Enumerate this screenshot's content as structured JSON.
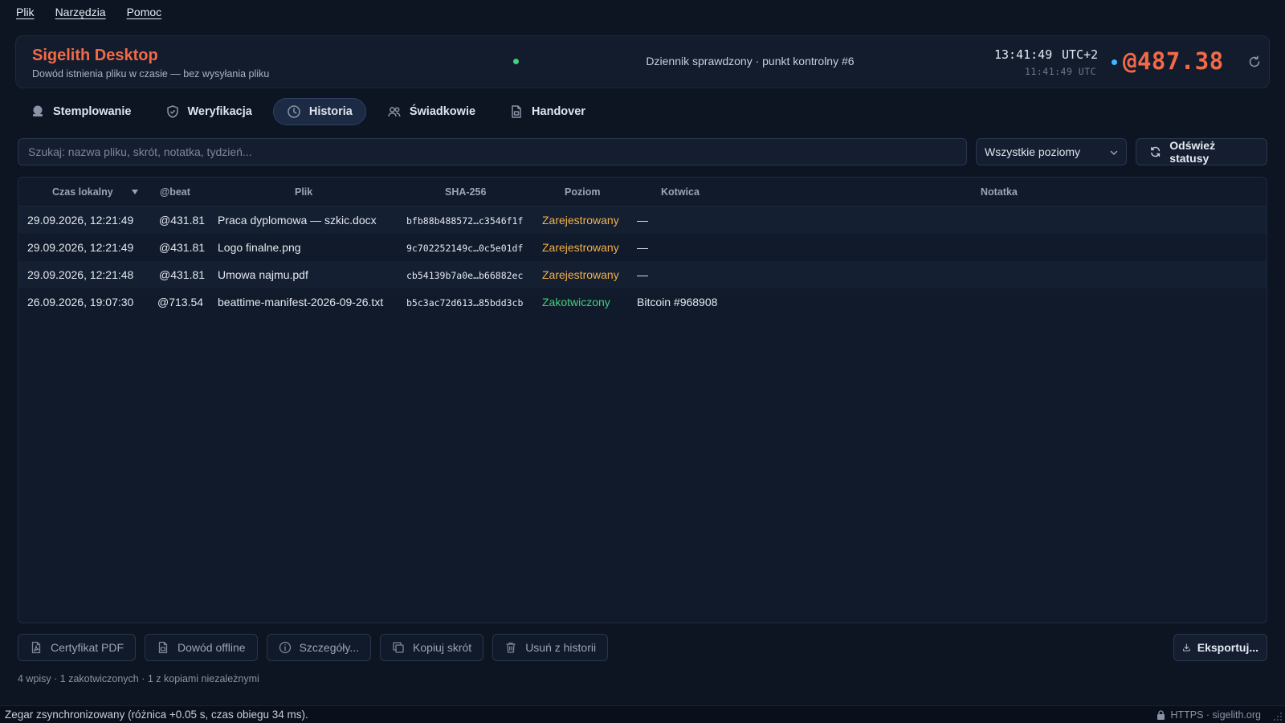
{
  "menu": {
    "items": [
      "Plik",
      "Narzędzia",
      "Pomoc"
    ]
  },
  "header": {
    "title": "Sigelith Desktop",
    "subtitle": "Dowód istnienia pliku w czasie — bez wysyłania pliku",
    "journal_status": "Dziennik sprawdzony · punkt kontrolny #6",
    "clock_local": "13:41:49",
    "clock_tz": "UTC+2",
    "clock_utc": "11:41:49 UTC",
    "beat": "@487.38"
  },
  "tabs": [
    {
      "label": "Stemplowanie",
      "icon": "stamp-icon",
      "active": false
    },
    {
      "label": "Weryfikacja",
      "icon": "shield-icon",
      "active": false
    },
    {
      "label": "Historia",
      "icon": "clock-icon",
      "active": true
    },
    {
      "label": "Świadkowie",
      "icon": "users-icon",
      "active": false
    },
    {
      "label": "Handover",
      "icon": "document-icon",
      "active": false
    }
  ],
  "search": {
    "placeholder": "Szukaj: nazwa pliku, skrót, notatka, tydzień..."
  },
  "level_filter": {
    "selected": "Wszystkie poziomy"
  },
  "refresh_button": "Odśwież statusy",
  "table": {
    "columns": [
      "Czas lokalny",
      "@beat",
      "Plik",
      "SHA-256",
      "Poziom",
      "Kotwica",
      "Notatka"
    ],
    "rows": [
      {
        "time": "29.09.2026, 12:21:49",
        "beat": "@431.81",
        "file": "Praca dyplomowa — szkic.docx",
        "hash": "bfb88b488572…c3546f1f",
        "level": "Zarejestrowany",
        "anchor": "—",
        "note": ""
      },
      {
        "time": "29.09.2026, 12:21:49",
        "beat": "@431.81",
        "file": "Logo finalne.png",
        "hash": "9c702252149c…0c5e01df",
        "level": "Zarejestrowany",
        "anchor": "—",
        "note": ""
      },
      {
        "time": "29.09.2026, 12:21:48",
        "beat": "@431.81",
        "file": "Umowa najmu.pdf",
        "hash": "cb54139b7a0e…b66882ec",
        "level": "Zarejestrowany",
        "anchor": "—",
        "note": ""
      },
      {
        "time": "26.09.2026, 19:07:30",
        "beat": "@713.54",
        "file": "beattime-manifest-2026-09-26.txt",
        "hash": "b5c3ac72d613…85bdd3cb",
        "level": "Zakotwiczony",
        "anchor": "Bitcoin #968908",
        "note": ""
      }
    ]
  },
  "actions": {
    "pdf": "Certyfikat PDF",
    "offline": "Dowód offline",
    "details": "Szczegóły...",
    "copy": "Kopiuj skrót",
    "delete": "Usuń z historii",
    "export": "Eksportuj..."
  },
  "summary": "4 wpisy · 1 zakotwiczonych · 1 z kopiami niezależnymi",
  "statusbar": {
    "message": "Zegar zsynchronizowany (różnica +0.05 s, czas obiegu 34 ms).",
    "connection": "HTTPS · sigelith.org"
  },
  "colors": {
    "accent": "#f26a47",
    "registered": "#f2b14a",
    "anchored": "#3ed27c",
    "background": "#0d1422"
  }
}
